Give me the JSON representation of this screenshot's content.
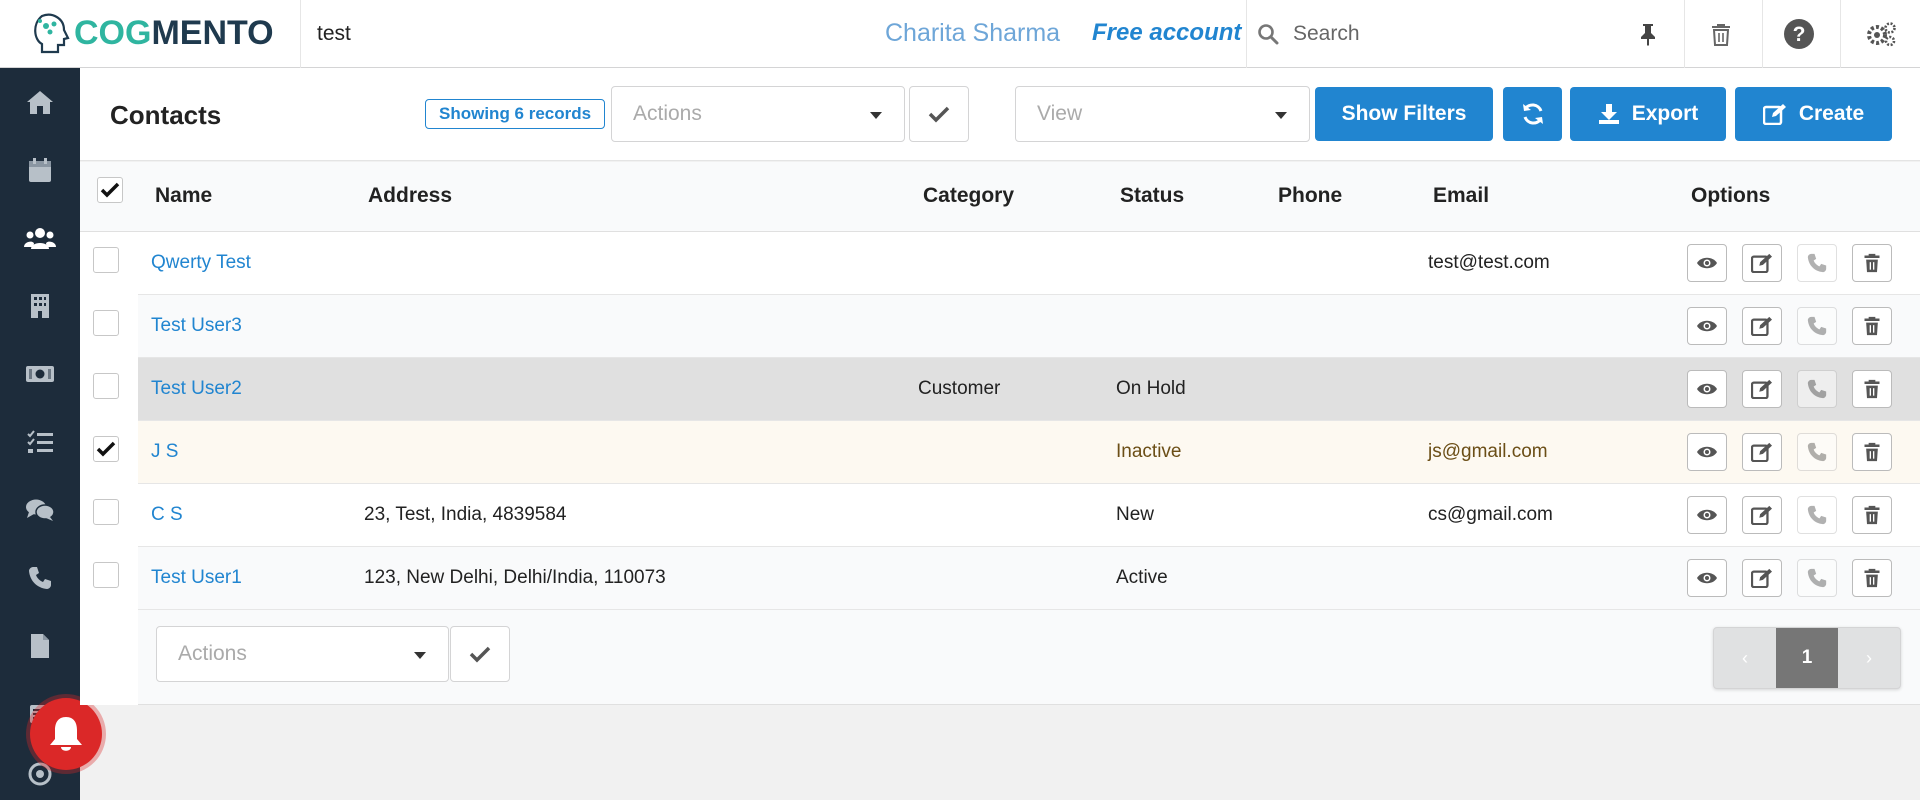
{
  "app": {
    "logo_text_cog": "COG",
    "logo_text_mento": "MENTO",
    "module_label": "test",
    "user_name": "Charita Sharma",
    "account_type": "Free account",
    "search_placeholder": "Search"
  },
  "header": {
    "title": "Contacts",
    "record_count": "Showing 6 records",
    "actions_placeholder": "Actions",
    "view_placeholder": "View",
    "show_filters_label": "Show Filters",
    "export_label": "Export",
    "create_label": "Create"
  },
  "sidebar": {
    "items": [
      "home-icon",
      "calendar-icon",
      "users-icon",
      "building-icon",
      "money-icon",
      "tasks-icon",
      "comments-icon",
      "phone-icon",
      "file-icon",
      "list-icon",
      "target-icon"
    ]
  },
  "table": {
    "columns": [
      "Name",
      "Address",
      "Category",
      "Status",
      "Phone",
      "Email",
      "Options"
    ],
    "header_checked": true,
    "rows": [
      {
        "name": "Qwerty Test",
        "address": "",
        "category": "",
        "status": "",
        "phone": "",
        "email": "test@test.com",
        "checked": false
      },
      {
        "name": "Test User3",
        "address": "",
        "category": "",
        "status": "",
        "phone": "",
        "email": "",
        "checked": false
      },
      {
        "name": "Test User2",
        "address": "",
        "category": "Customer",
        "status": "On Hold",
        "phone": "",
        "email": "",
        "checked": false
      },
      {
        "name": "J S",
        "address": "",
        "category": "",
        "status": "Inactive",
        "phone": "",
        "email": "js@gmail.com",
        "checked": true
      },
      {
        "name": "C S",
        "address": "23, Test, India, 4839584",
        "category": "",
        "status": "New",
        "phone": "",
        "email": "cs@gmail.com",
        "checked": false
      },
      {
        "name": "Test User1",
        "address": "123, New Delhi, Delhi/India, 110073",
        "category": "",
        "status": "Active",
        "phone": "",
        "email": "",
        "checked": false
      }
    ]
  },
  "footer": {
    "actions_placeholder": "Actions",
    "current_page": "1"
  },
  "colors": {
    "accent": "#2185d0",
    "sidebar_bg": "#1d2c3b",
    "hover_row": "#e0e0e0",
    "selected_row": "#fdf9f1",
    "selected_text": "#6b4e16",
    "notification": "#db2828"
  }
}
